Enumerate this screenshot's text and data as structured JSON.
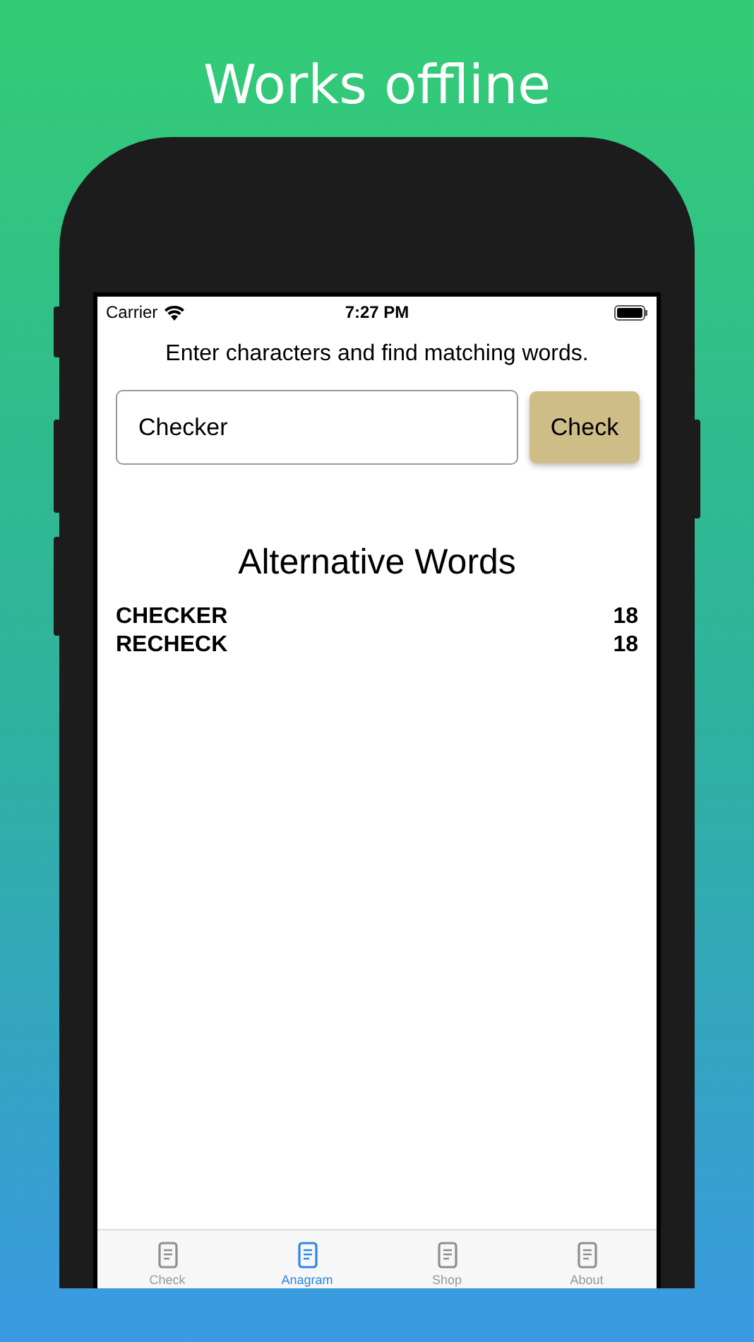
{
  "headline": "Works offline",
  "status_bar": {
    "carrier": "Carrier",
    "time": "7:27 PM"
  },
  "instruction": "Enter characters and find matching words.",
  "search": {
    "value": "Checker",
    "button": "Check"
  },
  "results": {
    "title": "Alternative Words",
    "rows": [
      {
        "word": "CHECKER",
        "score": "18"
      },
      {
        "word": "RECHECK",
        "score": "18"
      }
    ]
  },
  "tabs": [
    {
      "label": "Check",
      "selected": false
    },
    {
      "label": "Anagram",
      "selected": true
    },
    {
      "label": "Shop",
      "selected": false
    },
    {
      "label": "About",
      "selected": false
    }
  ]
}
